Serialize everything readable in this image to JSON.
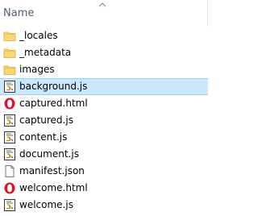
{
  "header": {
    "name_column": "Name"
  },
  "files": [
    {
      "name": "_locales",
      "icon": "folder-icon"
    },
    {
      "name": "_metadata",
      "icon": "folder-icon"
    },
    {
      "name": "images",
      "icon": "folder-icon"
    },
    {
      "name": "background.js",
      "icon": "js-script-icon",
      "selected": true
    },
    {
      "name": "captured.html",
      "icon": "opera-html-icon"
    },
    {
      "name": "captured.js",
      "icon": "js-script-icon"
    },
    {
      "name": "content.js",
      "icon": "js-script-icon"
    },
    {
      "name": "document.js",
      "icon": "js-script-icon"
    },
    {
      "name": "manifest.json",
      "icon": "blank-file-icon"
    },
    {
      "name": "welcome.html",
      "icon": "opera-html-icon"
    },
    {
      "name": "welcome.js",
      "icon": "js-script-icon"
    }
  ],
  "colors": {
    "selection": "#cce8ff",
    "selection_border": "#99d1ff",
    "header_text": "#4c607a",
    "folder": "#f8d775",
    "opera_red": "#e0122a"
  }
}
